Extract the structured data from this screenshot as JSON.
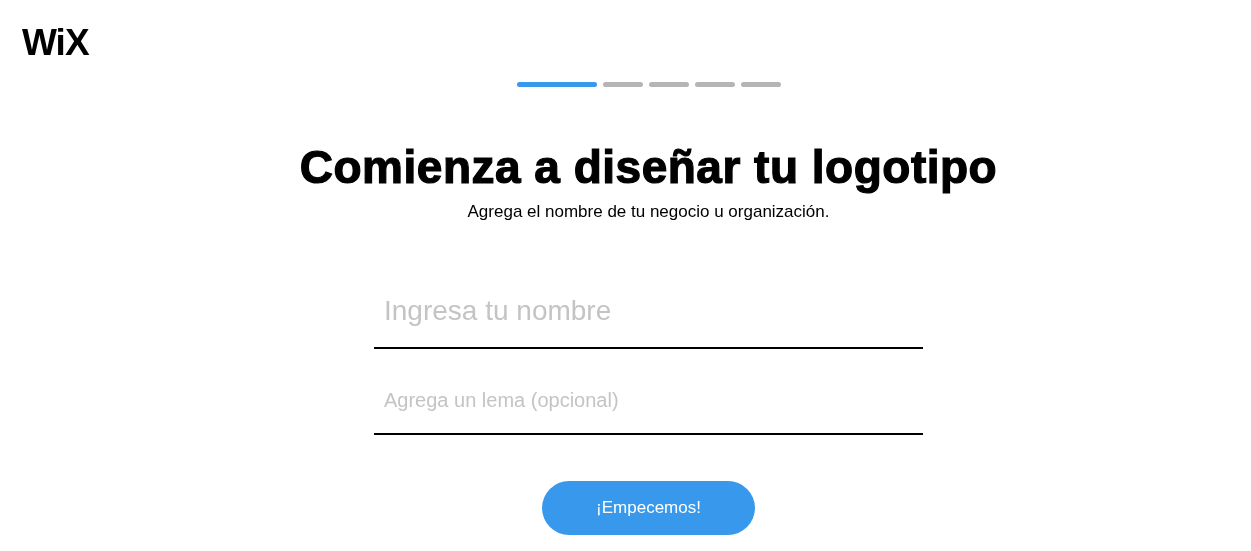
{
  "logo": "WiX",
  "steps": [
    {
      "done": true
    },
    {
      "done": false
    },
    {
      "done": false
    },
    {
      "done": false
    },
    {
      "done": false
    }
  ],
  "title": "Comienza a diseñar tu logotipo",
  "subtitle": "Agrega el nombre de tu negocio u organización.",
  "fields": [
    {
      "kind": "large",
      "placeholder": "Ingresa tu nombre"
    },
    {
      "kind": "small",
      "placeholder": "Agrega un lema (opcional)"
    }
  ],
  "button": "¡Empecemos!"
}
